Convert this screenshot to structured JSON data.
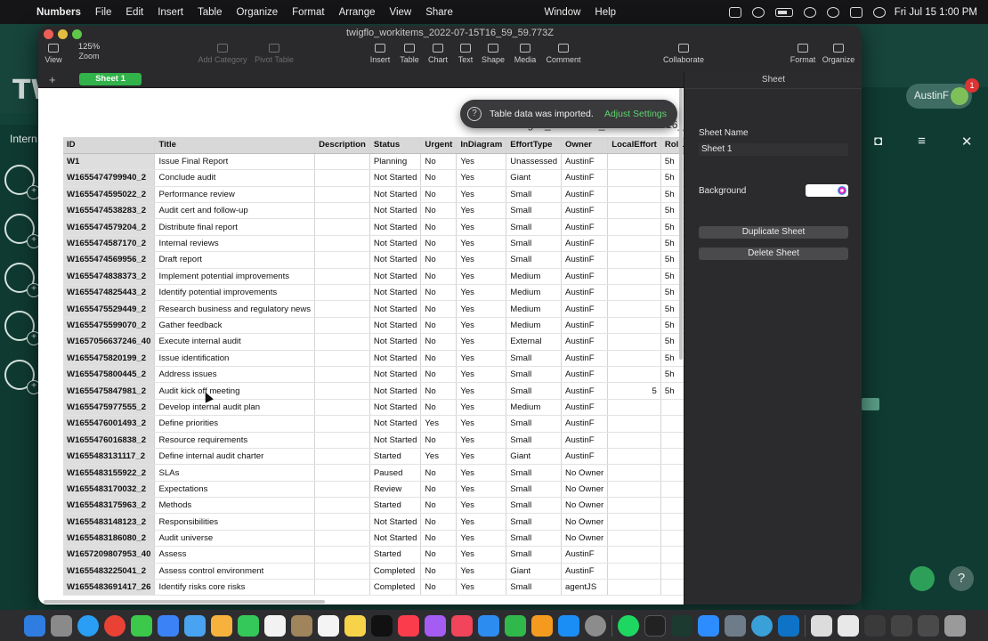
{
  "menubar": {
    "app_name": "Numbers",
    "items": [
      "File",
      "Edit",
      "Insert",
      "Table",
      "Organize",
      "Format",
      "Arrange",
      "View",
      "Share",
      "Window",
      "Help"
    ],
    "clock": "Fri Jul 15  1:00 PM"
  },
  "window": {
    "title": "twigflo_workitems_2022-07-15T16_59_59.773Z",
    "zoom": "125%",
    "toolbar": {
      "view": "View",
      "zoom": "Zoom",
      "add_category": "Add Category",
      "pivot_table": "Pivot Table",
      "insert": "Insert",
      "table": "Table",
      "chart": "Chart",
      "text": "Text",
      "shape": "Shape",
      "media": "Media",
      "comment": "Comment",
      "collaborate": "Collaborate",
      "format": "Format",
      "organize": "Organize"
    },
    "sheet_tab": "Sheet 1",
    "canvas_title_fragment": "twigflo_workitems_2022-07-15T16_5"
  },
  "toast": {
    "message": "Table data was imported.",
    "action": "Adjust Settings"
  },
  "inspector": {
    "header": "Sheet",
    "sheet_name_label": "Sheet Name",
    "sheet_name_value": "Sheet 1",
    "background_label": "Background",
    "duplicate_button": "Duplicate Sheet",
    "delete_button": "Delete Sheet"
  },
  "table": {
    "columns": [
      "ID",
      "Title",
      "Description",
      "Status",
      "Urgent",
      "InDiagram",
      "EffortType",
      "Owner",
      "LocalEffort",
      "RollupEffo"
    ],
    "rows": [
      [
        "W1",
        "Issue Final Report",
        "",
        "Planning",
        "No",
        "Yes",
        "Unassessed",
        "AustinF",
        "",
        "5h"
      ],
      [
        "W1655474799940_2",
        "Conclude audit",
        "",
        "Not Started",
        "No",
        "Yes",
        "Giant",
        "AustinF",
        "",
        "5h"
      ],
      [
        "W1655474595022_2",
        "Performance review",
        "",
        "Not Started",
        "No",
        "Yes",
        "Small",
        "AustinF",
        "",
        "5h"
      ],
      [
        "W1655474538283_2",
        "Audit cert and follow-up",
        "",
        "Not Started",
        "No",
        "Yes",
        "Small",
        "AustinF",
        "",
        "5h"
      ],
      [
        "W1655474579204_2",
        "Distribute final report",
        "",
        "Not Started",
        "No",
        "Yes",
        "Small",
        "AustinF",
        "",
        "5h"
      ],
      [
        "W1655474587170_2",
        "Internal reviews",
        "",
        "Not Started",
        "No",
        "Yes",
        "Small",
        "AustinF",
        "",
        "5h"
      ],
      [
        "W1655474569956_2",
        "Draft report",
        "",
        "Not Started",
        "No",
        "Yes",
        "Small",
        "AustinF",
        "",
        "5h"
      ],
      [
        "W1655474838373_2",
        "Implement potential improvements",
        "",
        "Not Started",
        "No",
        "Yes",
        "Medium",
        "AustinF",
        "",
        "5h"
      ],
      [
        "W1655474825443_2",
        "Identify potential improvements",
        "",
        "Not Started",
        "No",
        "Yes",
        "Medium",
        "AustinF",
        "",
        "5h"
      ],
      [
        "W1655475529449_2",
        "Research business and regulatory news",
        "",
        "Not Started",
        "No",
        "Yes",
        "Medium",
        "AustinF",
        "",
        "5h"
      ],
      [
        "W1655475599070_2",
        "Gather feedback",
        "",
        "Not Started",
        "No",
        "Yes",
        "Medium",
        "AustinF",
        "",
        "5h"
      ],
      [
        "W1657056637246_40",
        "Execute internal audit",
        "",
        "Not Started",
        "No",
        "Yes",
        "External",
        "AustinF",
        "",
        "5h"
      ],
      [
        "W1655475820199_2",
        "Issue identification",
        "",
        "Not Started",
        "No",
        "Yes",
        "Small",
        "AustinF",
        "",
        "5h"
      ],
      [
        "W1655475800445_2",
        "Address issues",
        "",
        "Not Started",
        "No",
        "Yes",
        "Small",
        "AustinF",
        "",
        "5h"
      ],
      [
        "W1655475847981_2",
        "Audit kick off meeting",
        "",
        "Not Started",
        "No",
        "Yes",
        "Small",
        "AustinF",
        "5",
        "5h"
      ],
      [
        "W1655475977555_2",
        "Develop internal audit plan",
        "",
        "Not Started",
        "No",
        "Yes",
        "Medium",
        "AustinF",
        "",
        ""
      ],
      [
        "W1655476001493_2",
        "Define priorities",
        "",
        "Not Started",
        "Yes",
        "Yes",
        "Small",
        "AustinF",
        "",
        ""
      ],
      [
        "W1655476016838_2",
        "Resource requirements",
        "",
        "Not Started",
        "No",
        "Yes",
        "Small",
        "AustinF",
        "",
        ""
      ],
      [
        "W1655483131117_2",
        "Define internal audit charter",
        "",
        "Started",
        "Yes",
        "Yes",
        "Giant",
        "AustinF",
        "",
        ""
      ],
      [
        "W1655483155922_2",
        "SLAs",
        "",
        "Paused",
        "No",
        "Yes",
        "Small",
        "No Owner",
        "",
        ""
      ],
      [
        "W1655483170032_2",
        "Expectations",
        "",
        "Review",
        "No",
        "Yes",
        "Small",
        "No Owner",
        "",
        ""
      ],
      [
        "W1655483175963_2",
        "Methods",
        "",
        "Started",
        "No",
        "Yes",
        "Small",
        "No Owner",
        "",
        ""
      ],
      [
        "W1655483148123_2",
        "Responsibilities",
        "",
        "Not Started",
        "No",
        "Yes",
        "Small",
        "No Owner",
        "",
        ""
      ],
      [
        "W1655483186080_2",
        "Audit universe",
        "",
        "Not Started",
        "No",
        "Yes",
        "Small",
        "No Owner",
        "",
        ""
      ],
      [
        "W1657209807953_40",
        "Assess",
        "",
        "Started",
        "No",
        "Yes",
        "Small",
        "AustinF",
        "",
        ""
      ],
      [
        "W1655483225041_2",
        "Assess control environment",
        "",
        "Completed",
        "No",
        "Yes",
        "Giant",
        "AustinF",
        "",
        ""
      ],
      [
        "W1655483691417_26",
        "Identify risks core risks",
        "",
        "Completed",
        "No",
        "Yes",
        "Small",
        "agentJS",
        "",
        ""
      ]
    ]
  },
  "background_app": {
    "logo": "TW",
    "section": "Intern",
    "user": "AustinF",
    "notification_count": "1"
  },
  "colors": {
    "accent_green": "#31b24a",
    "toast_action": "#5fd36f",
    "bg_app": "#124238"
  }
}
